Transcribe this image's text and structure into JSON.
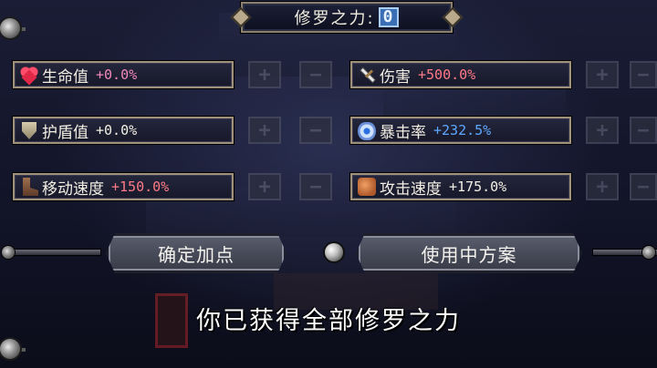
{
  "title": {
    "label": "修罗之力:",
    "count": "0"
  },
  "stats": [
    {
      "id": "health",
      "name": "生命值",
      "value": "+0.0%",
      "icon": "heart-icon",
      "color": "#f08ab8"
    },
    {
      "id": "damage",
      "name": "伤害",
      "value": "+500.0%",
      "icon": "sword-icon",
      "color": "#ff7a86"
    },
    {
      "id": "shield",
      "name": "护盾值",
      "value": "+0.0%",
      "icon": "shield-icon",
      "color": "#f3efe4"
    },
    {
      "id": "crit",
      "name": "暴击率",
      "value": "+232.5%",
      "icon": "eye-icon",
      "color": "#5ea9ff"
    },
    {
      "id": "move_speed",
      "name": "移动速度",
      "value": "+150.0%",
      "icon": "boot-icon",
      "color": "#ff7a86"
    },
    {
      "id": "attack_speed",
      "name": "攻击速度",
      "value": "+175.0%",
      "icon": "fist-icon",
      "color": "#f3efe4"
    }
  ],
  "buttons": {
    "plus": "+",
    "minus": "−",
    "confirm": "确定加点",
    "in_use": "使用中方案"
  },
  "message": "你已获得全部修罗之力"
}
